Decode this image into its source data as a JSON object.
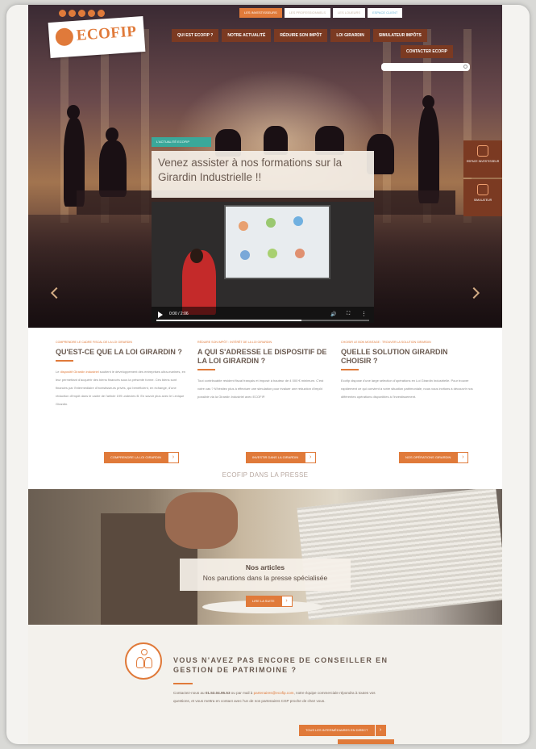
{
  "header": {
    "social_icons": [
      "facebook-icon",
      "twitter-icon",
      "linkedin-icon",
      "youtube-icon",
      "rss-icon"
    ],
    "logo_text": "ECOFIP",
    "topbar": [
      {
        "label": "LES INVESTISSEURS",
        "active": true
      },
      {
        "label": "LES PROFESSIONNELS",
        "active": false
      },
      {
        "label": "LES LOUEURS",
        "active": false
      },
      {
        "label": "ESPACE CLIENT",
        "active": false
      }
    ],
    "nav": [
      {
        "label": "QUI EST ECOFIP ?"
      },
      {
        "label": "NOTRE ACTUALITÉ"
      },
      {
        "label": "RÉDUIRE SON IMPÔT"
      },
      {
        "label": "LOI GIRARDIN"
      },
      {
        "label": "SIMULATEUR IMPÔTS"
      },
      {
        "label": "CONTACTER ECOFIP"
      }
    ],
    "search_placeholder": ""
  },
  "hero": {
    "tag": "L'ACTUALITÉ ECOFIP",
    "title": "Venez assister à nos formations sur la Girardin Industrielle !!",
    "video": {
      "time": "0:00 / 2:06",
      "progress": 0.68
    },
    "side_boxes": [
      {
        "icon": "lock-icon",
        "label": "ESPACE INVESTISSEUR"
      },
      {
        "icon": "hand-icon",
        "label": "SIMULATEUR"
      }
    ]
  },
  "columns": [
    {
      "kicker": "COMPRENDRE LE CADRE FISCAL DE LA LOI GIRARDIN",
      "title": "QU'EST-CE QUE LA LOI GIRARDIN ?",
      "text_link": "dispositif Girardin industriel",
      "text_pre": "Le",
      "text_post": "soutient le développement des entreprises ultra-marines, en leur permettant d'acquérir des biens financés sous la présente forme. Ces biens sont financés par l'intermédiaire d'investisseurs privés, qui bénéficient, en échange, d'une réduction d'impôt dans le cadre de l'article 199 undecies B. En savoir plus avec le Lexique Girardin.",
      "button": "COMPRENDRE LA LOI GIRARDIN"
    },
    {
      "kicker": "RÉDUIRE SON IMPÔT : INTÉRÊT DE LA LOI GIRARDIN",
      "title": "A QUI S'ADRESSE LE DISPOSITIF DE LA LOI GIRARDIN ?",
      "text": "Tout contribuable résident fiscal français et imposé à hauteur de 4 000 € minimum. C'est votre cas ? N'hésitez plus à effectuer une simulation pour évaluer une réduction d'impôt possible via la Girardin Industriel avec ECOFIP.",
      "button": "INVESTIR DANS LA GIRARDIN"
    },
    {
      "kicker": "CHOISIR LE BON MONTAGE : TROUVER LA SOLUTION GIRARDIN",
      "title": "QUELLE SOLUTION GIRARDIN CHOISIR ?",
      "text": "Ecofip dispose d'une large sélection d'opérations en Loi Girardin Industrielle. Pour trouver rapidement ce qui convient à votre situation patrimoniale, nous vous invitons à découvrir nos différentes opérations disponibles à l'investissement.",
      "button": "NOS OPÉRATIONS GIRARDIN"
    }
  ],
  "presse": {
    "section_title": "ECOFIP DANS LA PRESSE",
    "box_title": "Nos articles",
    "box_subtitle": "Nos parutions dans la presse spécialisée",
    "button": "LIRE LA SUITE"
  },
  "conseiller": {
    "heading": "VOUS N'AVEZ PAS ENCORE DE CONSEILLER EN GESTION DE PATRIMOINE ?",
    "text_pre": "Contactez-nous au",
    "phone": "01.53.04.95.53",
    "text_mid": "ou par mail à",
    "email": "partenaires@ecofip.com",
    "text_post": ", notre équipe commerciale répondra à toutes vos questions, et vous mettra en contact avec l'un de nos partenaires CGP proche de chez vous.",
    "button": "TOUS LES INTERMÉDIAIRES EN DIRECT"
  },
  "colors": {
    "accent": "#e07a3a",
    "nav_bg": "#7b3a22",
    "teal": "#3aa89a"
  }
}
